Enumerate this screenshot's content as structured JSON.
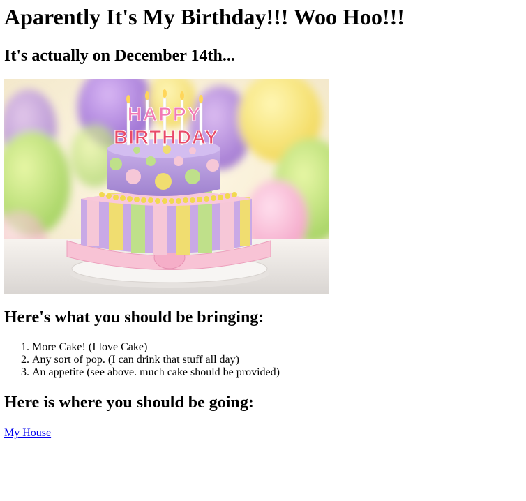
{
  "page": {
    "title": "Aparently It's My Birthday!!! Woo Hoo!!!",
    "subtitle": "It's actually on December 14th...",
    "image": {
      "sign_line1": "HAPPY",
      "sign_line2": "BIRTHDAY",
      "colors": {
        "background": "#f4e9c8",
        "cake_purple": "#b497d6",
        "cake_pink": "#f6c2d2",
        "cake_yellow": "#f0dc70",
        "cake_green": "#bfe08a",
        "plate": "#f1f1f1"
      }
    },
    "bring_heading": "Here's what you should be bringing:",
    "bring_items": [
      "More Cake! (I love Cake)",
      "Any sort of pop. (I can drink that stuff all day)",
      "An appetite (see above. much cake should be provided)"
    ],
    "going_heading": "Here is where you should be going:",
    "location_link": "My House"
  }
}
